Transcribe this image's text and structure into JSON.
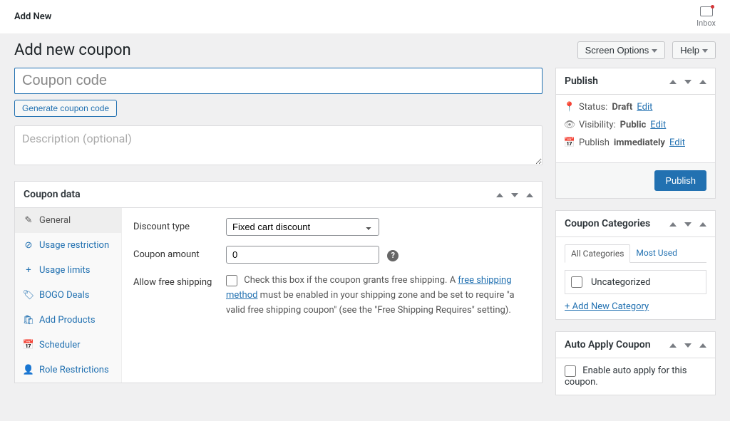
{
  "topbar": {
    "title": "Add New",
    "inbox_label": "Inbox"
  },
  "header": {
    "page_title": "Add new coupon",
    "screen_options": "Screen Options",
    "help": "Help"
  },
  "form": {
    "code_placeholder": "Coupon code",
    "generate_label": "Generate coupon code",
    "desc_placeholder": "Description (optional)"
  },
  "coupon_panel": {
    "title": "Coupon data",
    "tabs": {
      "general": "General",
      "usage_restriction": "Usage restriction",
      "usage_limits": "Usage limits",
      "bogo": "BOGO Deals",
      "add_products": "Add Products",
      "scheduler": "Scheduler",
      "role_restrictions": "Role Restrictions"
    },
    "fields": {
      "discount_type_label": "Discount type",
      "discount_type_value": "Fixed cart discount",
      "coupon_amount_label": "Coupon amount",
      "coupon_amount_value": "0",
      "shipping_label": "Allow free shipping",
      "shipping_text_1": "Check this box if the coupon grants free shipping. A ",
      "shipping_link": "free shipping method",
      "shipping_text_2": " must be enabled in your shipping zone and be set to require \"a valid free shipping coupon\" (see the \"Free Shipping Requires\" setting)."
    }
  },
  "publish": {
    "title": "Publish",
    "status_label": "Status:",
    "status_value": "Draft",
    "visibility_label": "Visibility:",
    "visibility_value": "Public",
    "publish_label": "Publish",
    "publish_value": "immediately",
    "edit": "Edit",
    "button": "Publish"
  },
  "categories": {
    "title": "Coupon Categories",
    "tab_all": "All Categories",
    "tab_most": "Most Used",
    "uncategorized": "Uncategorized",
    "add_new": "+ Add New Category"
  },
  "auto_apply": {
    "title": "Auto Apply Coupon",
    "checkbox_label": "Enable auto apply for this coupon."
  }
}
